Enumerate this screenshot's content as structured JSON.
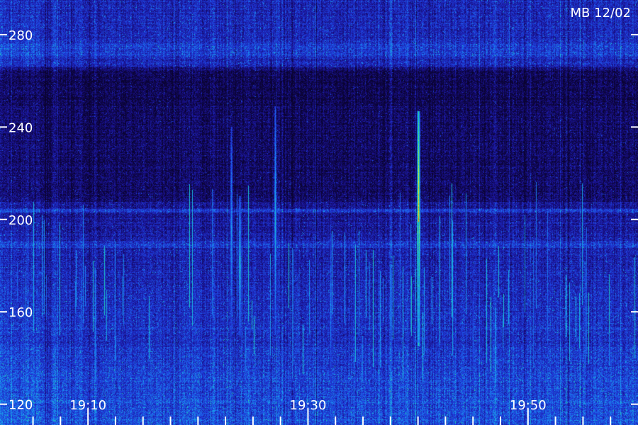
{
  "chart_data": {
    "type": "heatmap",
    "title": "",
    "station_label": "MB 12/02",
    "xlabel": "",
    "ylabel": "",
    "x_ticks": [
      "19:10",
      "19:30",
      "19:50"
    ],
    "x_minor_tick_step_minutes": 2.5,
    "xlim": [
      "19:02",
      "20:00"
    ],
    "y_ticks": [
      120,
      160,
      200,
      240,
      280
    ],
    "ylim": [
      111,
      295
    ],
    "grid": false,
    "colormap": [
      "#0a0330",
      "#1a1190",
      "#1f3fe0",
      "#19a8f0",
      "#22e08a",
      "#f0f020",
      "#ff3010"
    ],
    "bright_streaks": [
      {
        "time": "19:27",
        "f_low": 150,
        "f_high": 249,
        "intensity": 0.55
      },
      {
        "time": "19:40",
        "f_low": 145,
        "f_high": 247,
        "intensity": 0.95
      },
      {
        "time": "19:23",
        "f_low": 150,
        "f_high": 240,
        "intensity": 0.5
      },
      {
        "time": "19:23.8",
        "f_low": 150,
        "f_high": 210,
        "intensity": 0.6
      },
      {
        "time": "19:32",
        "f_low": 125,
        "f_high": 198,
        "intensity": 0.45
      },
      {
        "time": "19:45",
        "f_low": 125,
        "f_high": 170,
        "intensity": 0.4
      }
    ]
  }
}
